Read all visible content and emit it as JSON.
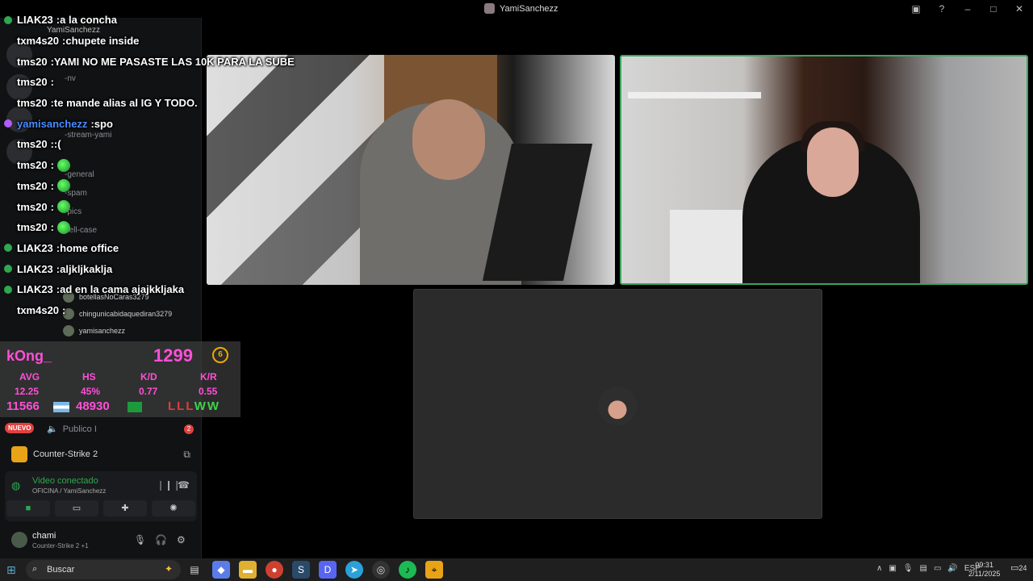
{
  "window": {
    "title": "YamiSanchezz"
  },
  "chat": [
    {
      "user": "LIAK23",
      "text": "a la concha",
      "color": "#ffffff",
      "badge": "#2fa84f"
    },
    {
      "user": "txm4s20",
      "text": "chupete inside",
      "color": "#ffffff",
      "badge": ""
    },
    {
      "user": "tms20",
      "text": "YAMI NO ME PASASTE LAS 10K PARA LA SUBE",
      "color": "#ffffff",
      "badge": ""
    },
    {
      "user": "tms20",
      "text": "",
      "color": "#ffffff",
      "badge": ""
    },
    {
      "user": "tms20",
      "text": "te mande alias al IG Y TODO.",
      "color": "#ffffff",
      "badge": ""
    },
    {
      "user": "yamisanchezz",
      "text": "spo",
      "color": "#4a8cff",
      "badge": "#b15cff"
    },
    {
      "user": "tms20",
      "text": ":(",
      "color": "#ffffff",
      "badge": ""
    },
    {
      "user": "tms20",
      "text": "",
      "color": "#ffffff",
      "badge": "",
      "emote": true
    },
    {
      "user": "tms20",
      "text": "",
      "color": "#ffffff",
      "badge": "",
      "emote": true
    },
    {
      "user": "tms20",
      "text": "",
      "color": "#ffffff",
      "badge": "",
      "emote": true
    },
    {
      "user": "tms20",
      "text": "",
      "color": "#ffffff",
      "badge": "",
      "emote": true
    },
    {
      "user": "LIAK23",
      "text": "home office",
      "color": "#ffffff",
      "badge": "#2fa84f"
    },
    {
      "user": "LIAK23",
      "text": "aljkljkaklja",
      "color": "#ffffff",
      "badge": "#2fa84f"
    },
    {
      "user": "LIAK23",
      "text": "ad en la cama ajajkkljaka",
      "color": "#ffffff",
      "badge": "#2fa84f"
    },
    {
      "user": "txm4s20",
      "text": "",
      "color": "#ffffff",
      "badge": ""
    }
  ],
  "sidebar": {
    "server_name": "YamiSanchezz",
    "channels": [
      "-nv",
      "-stream-yami",
      "-general",
      "-spam",
      "-pics",
      "hell-case"
    ],
    "members": [
      "botellasNoCaras3279",
      "chingunicabidaquediran3279",
      "yamisanchezz"
    ],
    "publico_label": "Publico I",
    "publico_badge": "2",
    "nuevo_label": "NUEVO"
  },
  "stats": {
    "name": "kOng_",
    "elo": "1299",
    "level": "6",
    "headers": [
      "AVG",
      "HS",
      "K/D",
      "K/R"
    ],
    "values": [
      "12.25",
      "45%",
      "0.77",
      "0.55"
    ],
    "rank_ar": "11566",
    "rank_br": "48930",
    "form": [
      "L",
      "L",
      "L",
      "W",
      "W"
    ]
  },
  "game": {
    "name": "Counter-Strike 2"
  },
  "voice": {
    "status": "Video conectado",
    "channel": "OFICINA / YamiSanchezz"
  },
  "user": {
    "name": "chami",
    "status": "Counter-Strike 2 +1"
  },
  "taskbar": {
    "search_label": "Buscar",
    "lang": "ESP",
    "time": "09:31",
    "date": "2/11/2025",
    "notif": "24"
  }
}
